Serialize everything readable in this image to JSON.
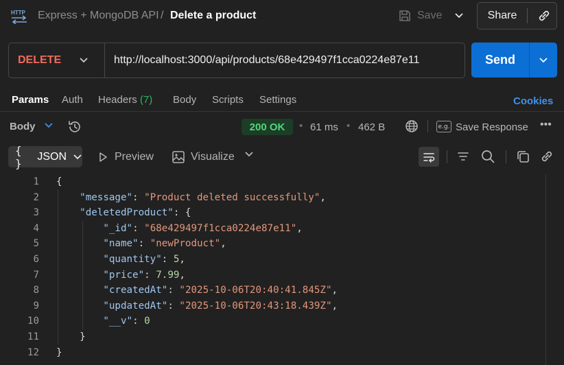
{
  "header": {
    "app_icon": "http-icon",
    "collection": "Express + MongoDB API",
    "separator": "/",
    "request_name": "Delete a product",
    "save_label": "Save",
    "share_label": "Share"
  },
  "request": {
    "method": "DELETE",
    "url": "http://localhost:3000/api/products/68e429497f1cca0224e87e11",
    "send_label": "Send",
    "method_color": "#f26b5b"
  },
  "tabs": [
    {
      "label": "Params",
      "active": true
    },
    {
      "label": "Auth"
    },
    {
      "label": "Headers",
      "count": "(7)"
    },
    {
      "label": "Body"
    },
    {
      "label": "Scripts"
    },
    {
      "label": "Settings"
    }
  ],
  "cookies_label": "Cookies",
  "response": {
    "body_label": "Body",
    "status": "200 OK",
    "time": "61 ms",
    "size": "462 B",
    "eg_label": "e.g.",
    "save_response_label": "Save Response",
    "more": "•••",
    "format": {
      "braces": "{ }",
      "label": "JSON"
    },
    "preview_label": "Preview",
    "visualize_label": "Visualize"
  },
  "code_lines": [
    {
      "n": "1",
      "tokens": [
        [
          "p",
          "{"
        ]
      ]
    },
    {
      "n": "2",
      "tokens": [
        [
          "p",
          "    "
        ],
        [
          "k",
          "\"message\""
        ],
        [
          "p",
          ": "
        ],
        [
          "s",
          "\"Product deleted successfully\""
        ],
        [
          "p",
          ","
        ]
      ]
    },
    {
      "n": "3",
      "tokens": [
        [
          "p",
          "    "
        ],
        [
          "k",
          "\"deletedProduct\""
        ],
        [
          "p",
          ": {"
        ]
      ]
    },
    {
      "n": "4",
      "tokens": [
        [
          "p",
          "        "
        ],
        [
          "k",
          "\"_id\""
        ],
        [
          "p",
          ": "
        ],
        [
          "s",
          "\"68e429497f1cca0224e87e11\""
        ],
        [
          "p",
          ","
        ]
      ]
    },
    {
      "n": "5",
      "tokens": [
        [
          "p",
          "        "
        ],
        [
          "k",
          "\"name\""
        ],
        [
          "p",
          ": "
        ],
        [
          "s",
          "\"newProduct\""
        ],
        [
          "p",
          ","
        ]
      ]
    },
    {
      "n": "6",
      "tokens": [
        [
          "p",
          "        "
        ],
        [
          "k",
          "\"quantity\""
        ],
        [
          "p",
          ": "
        ],
        [
          "n",
          "5"
        ],
        [
          "p",
          ","
        ]
      ]
    },
    {
      "n": "7",
      "tokens": [
        [
          "p",
          "        "
        ],
        [
          "k",
          "\"price\""
        ],
        [
          "p",
          ": "
        ],
        [
          "n",
          "7.99"
        ],
        [
          "p",
          ","
        ]
      ]
    },
    {
      "n": "8",
      "tokens": [
        [
          "p",
          "        "
        ],
        [
          "k",
          "\"createdAt\""
        ],
        [
          "p",
          ": "
        ],
        [
          "s",
          "\"2025-10-06T20:40:41.845Z\""
        ],
        [
          "p",
          ","
        ]
      ]
    },
    {
      "n": "9",
      "tokens": [
        [
          "p",
          "        "
        ],
        [
          "k",
          "\"updatedAt\""
        ],
        [
          "p",
          ": "
        ],
        [
          "s",
          "\"2025-10-06T20:43:18.439Z\""
        ],
        [
          "p",
          ","
        ]
      ]
    },
    {
      "n": "10",
      "tokens": [
        [
          "p",
          "        "
        ],
        [
          "k",
          "\"__v\""
        ],
        [
          "p",
          ": "
        ],
        [
          "n",
          "0"
        ]
      ]
    },
    {
      "n": "11",
      "tokens": [
        [
          "p",
          "    }"
        ]
      ]
    },
    {
      "n": "12",
      "tokens": [
        [
          "p",
          "}"
        ]
      ]
    }
  ],
  "colors": {
    "accent": "#0c6fd6",
    "status_ok": "#52d67c",
    "headers_count": "#2fb464",
    "cookies": "#3d93eb"
  }
}
